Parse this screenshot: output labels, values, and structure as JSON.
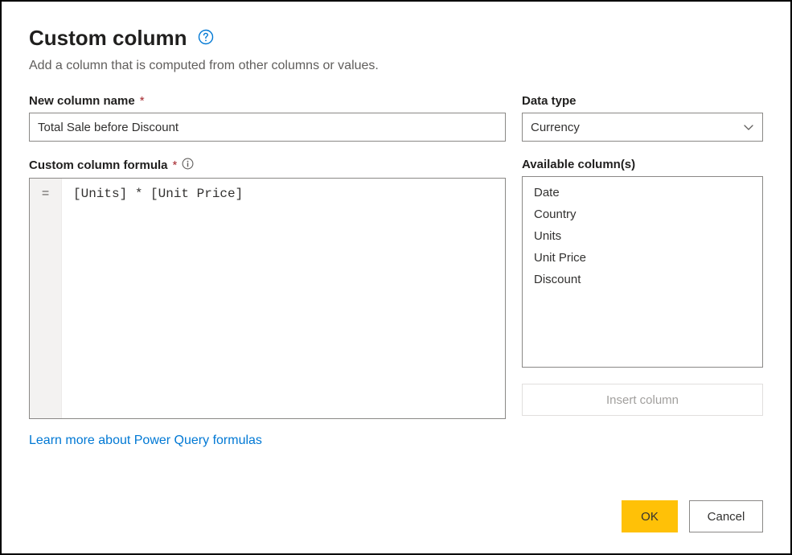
{
  "dialog": {
    "title": "Custom column",
    "subtitle": "Add a column that is computed from other columns or values."
  },
  "labels": {
    "new_column_name": "New column name",
    "data_type": "Data type",
    "formula": "Custom column formula",
    "available_columns": "Available column(s)",
    "required": "*"
  },
  "values": {
    "column_name": "Total Sale before Discount",
    "data_type_selected": "Currency",
    "formula_prefix": "=",
    "formula_text": "[Units] * [Unit Price]"
  },
  "available_columns": [
    "Date",
    "Country",
    "Units",
    "Unit Price",
    "Discount"
  ],
  "buttons": {
    "insert_column": "Insert column",
    "ok": "OK",
    "cancel": "Cancel"
  },
  "link": {
    "learn_more": "Learn more about Power Query formulas"
  }
}
